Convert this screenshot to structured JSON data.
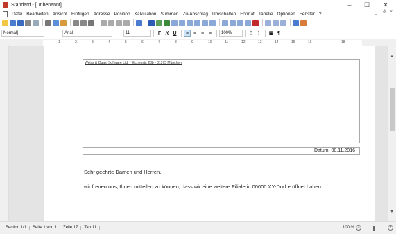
{
  "window": {
    "title": "Standard - [Unbenannt]",
    "minimize": "–",
    "maximize": "☐",
    "close": "✕"
  },
  "menubar": {
    "items": [
      "Datei",
      "Bearbeiten",
      "Ansicht",
      "Einfügen",
      "Adresse",
      "Position",
      "Kalkulation",
      "Summen",
      "Zu-Abschlag",
      "Umschalten",
      "Format",
      "Tabelle",
      "Optionen",
      "Fenster",
      "?"
    ],
    "mdi_min": "_",
    "mdi_restore": "ð",
    "mdi_close": "×"
  },
  "format_bar": {
    "style": "Normal]",
    "font": "Arial",
    "size": "11",
    "bold": "F",
    "italic": "K",
    "underline": "U",
    "zoom": "100%"
  },
  "ruler": {
    "marks": [
      "1",
      "2",
      "3",
      "4",
      "5",
      "6",
      "7",
      "8",
      "9",
      "10",
      "11",
      "12",
      "13",
      "14",
      "15",
      "16",
      "18"
    ]
  },
  "document": {
    "sender": "Weiss & Quasi Software Ltd. - Eichenstr. 28b - 81375 München",
    "date": "Datum: 08.11.2016",
    "salutation": "Sehr geehrte Damen und Herren,",
    "body": "wir freuen uns, Ihnen mitteilen zu können, dass wir eine weitere Filiale in 00000 XY-Dorf eröffnet haben. ................."
  },
  "statusbar": {
    "section": "Section 1/1",
    "page": "Seite 1 von 1",
    "line": "Zeile 17",
    "tab": "Tab 11",
    "zoom": "100 %"
  }
}
